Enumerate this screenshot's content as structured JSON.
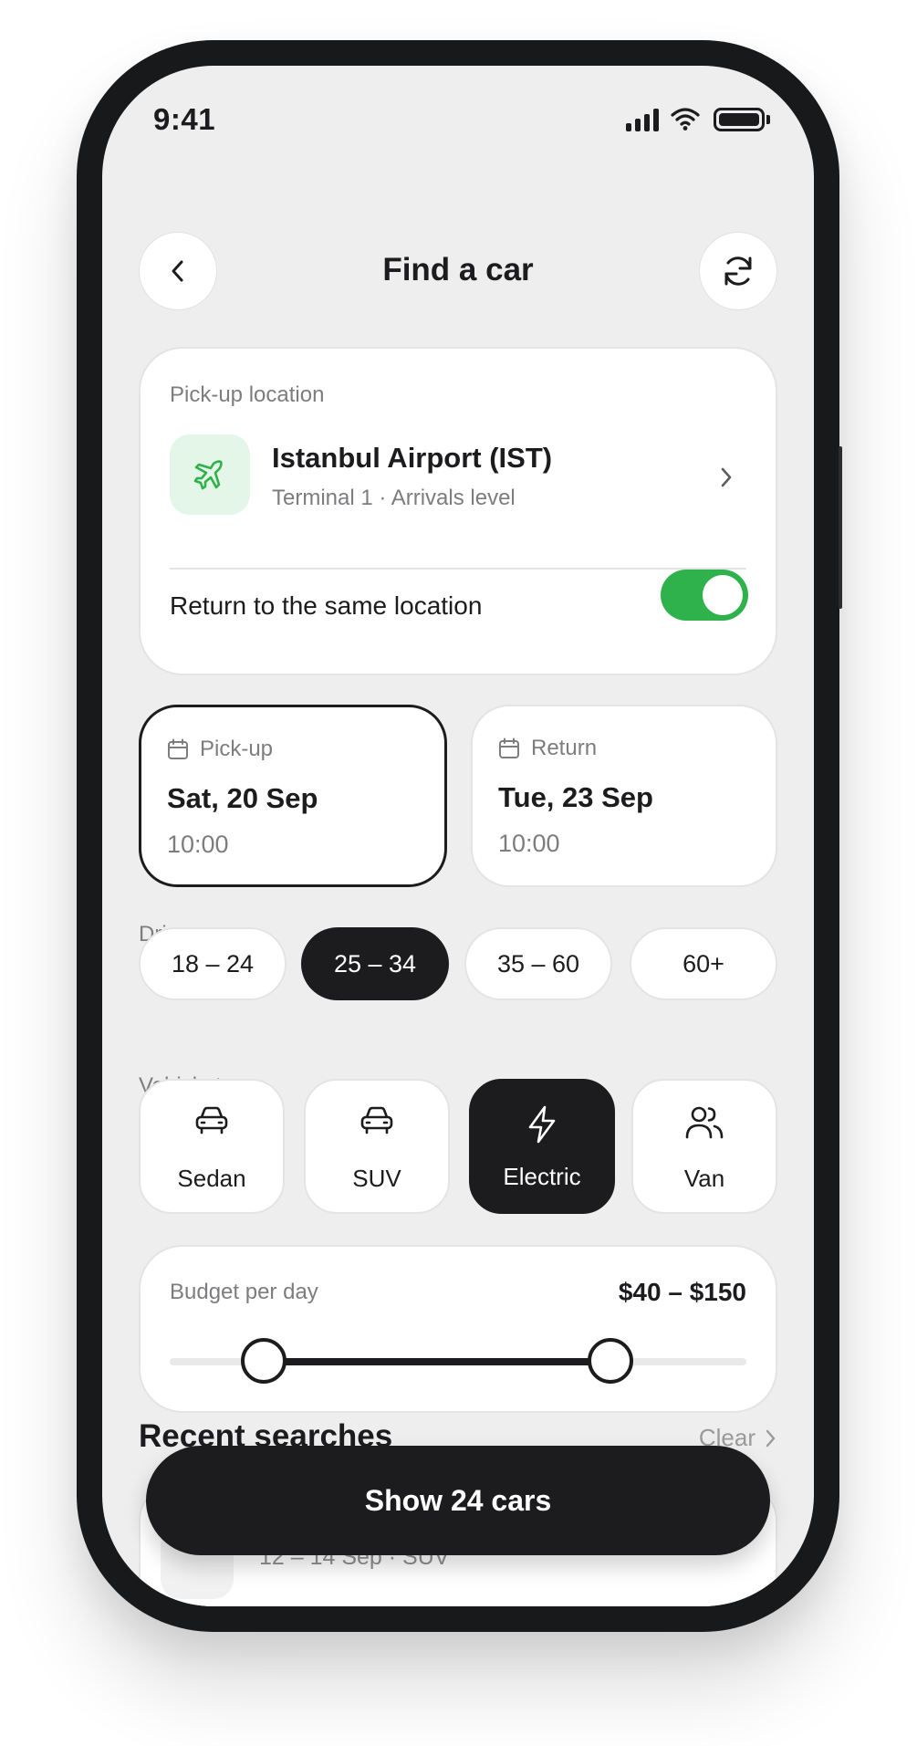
{
  "status_bar": {
    "time": "9:41"
  },
  "header": {
    "title": "Find a car",
    "back_icon": "chevron-left-icon",
    "refresh_icon": "refresh-icon"
  },
  "pickup_location": {
    "label": "Pick-up location",
    "name": "Istanbul Airport (IST)",
    "detail": "Terminal 1 · Arrivals level",
    "icon": "plane-icon",
    "accent": "#2fb14c",
    "return_same_label": "Return to the same location",
    "return_same_enabled": true
  },
  "dates": {
    "pickup": {
      "label": "Pick-up",
      "date": "Sat, 20 Sep",
      "time": "10:00"
    },
    "return": {
      "label": "Return",
      "date": "Tue, 23 Sep",
      "time": "10:00"
    }
  },
  "driver_age": {
    "label": "Driver age",
    "options": [
      "18 – 24",
      "25 – 34",
      "35 – 60",
      "60+"
    ],
    "selected": "25 – 34"
  },
  "vehicle_type": {
    "label": "Vehicle type",
    "options": [
      {
        "label": "Sedan",
        "icon": "car-icon"
      },
      {
        "label": "SUV",
        "icon": "car-icon"
      },
      {
        "label": "Electric",
        "icon": "lightning-icon"
      },
      {
        "label": "Van",
        "icon": "users-icon"
      }
    ],
    "selected": "Electric"
  },
  "budget": {
    "label": "Budget per day",
    "value_text": "$40 – $150",
    "range_min_fraction": 0.163,
    "range_max_fraction": 0.765
  },
  "recent": {
    "title": "Recent searches",
    "clear_label": "Clear",
    "item_subtitle": "12 – 14 Sep · SUV"
  },
  "cta": {
    "label": "Show 24 cars"
  }
}
